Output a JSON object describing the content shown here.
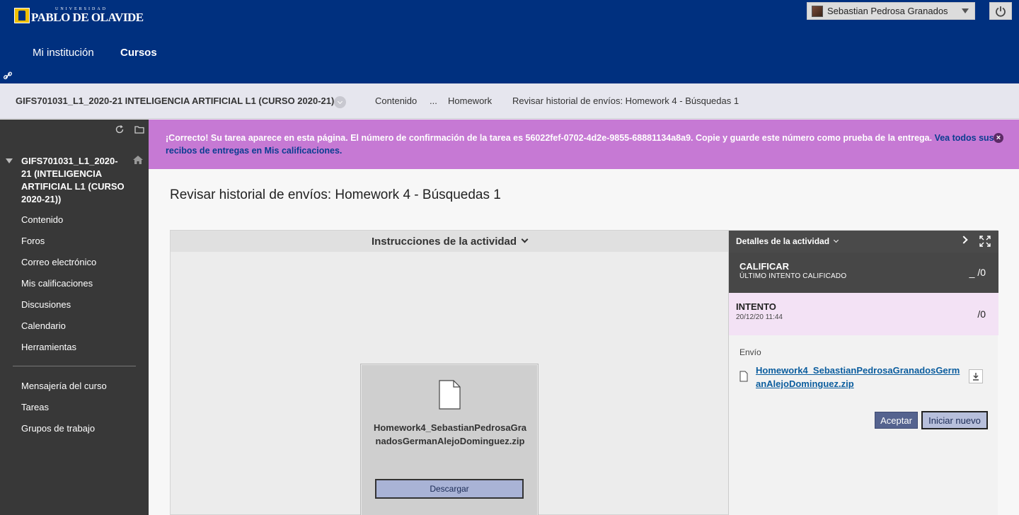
{
  "header": {
    "logo_text": "PABLO DE OLAVIDE",
    "logo_small": "UNIVERSIDAD",
    "user_name": "Sebastian Pedrosa Granados",
    "nav": [
      {
        "label": "Mi institución"
      },
      {
        "label": "Cursos"
      }
    ]
  },
  "breadcrumb": {
    "course": "GIFS701031_L1_2020-21 INTELIGENCIA ARTIFICIAL L1 (CURSO 2020-21)",
    "items": [
      "Contenido",
      "...",
      "Homework",
      "Revisar historial de envíos: Homework 4 - Búsquedas 1"
    ]
  },
  "sidebar": {
    "course": "GIFS701031_L1_2020-21 (INTELIGENCIA ARTIFICIAL L1 (CURSO 2020-21))",
    "items": [
      {
        "label": "Contenido"
      },
      {
        "label": "Foros"
      },
      {
        "label": "Correo electrónico"
      },
      {
        "label": "Mis calificaciones"
      },
      {
        "label": "Discusiones"
      },
      {
        "label": "Calendario"
      },
      {
        "label": "Herramientas"
      }
    ],
    "items2": [
      {
        "label": "Mensajería del curso"
      },
      {
        "label": "Tareas"
      },
      {
        "label": "Grupos de trabajo"
      }
    ]
  },
  "banner": {
    "text": "¡Correcto! Su tarea aparece en esta página. El número de confirmación de la tarea es 56022fef-0702-4d2e-9855-68881134a8a9. Copie y guarde este número como prueba de la entrega. ",
    "link": "Vea todos sus recibos de entregas en Mis calificaciones."
  },
  "page": {
    "title": "Revisar historial de envíos: Homework 4 - Búsquedas 1",
    "instructions_heading": "Instrucciones de la actividad"
  },
  "file_card": {
    "name": "Homework4_SebastianPedrosaGranadosGermanAlejoDominguez.zip",
    "download_label": "Descargar"
  },
  "details": {
    "heading": "Detalles de la actividad",
    "grade_title": "CALIFICAR",
    "grade_sub": "ÚLTIMO INTENTO CALIFICADO",
    "grade_value": "_ /0",
    "attempt_title": "INTENTO",
    "attempt_date": "20/12/20 11:44",
    "attempt_value": "/0",
    "submission_label": "Envío",
    "submission_file": "Homework4_SebastianPedrosaGranadosGermanAlejoDominguez.zip",
    "accept_label": "Aceptar",
    "new_label": "Iniciar nuevo"
  },
  "colors": {
    "header_bg": "#00307f",
    "banner_bg": "#c679d4",
    "sidebar_bg": "#383838",
    "link": "#0b5d9e"
  }
}
